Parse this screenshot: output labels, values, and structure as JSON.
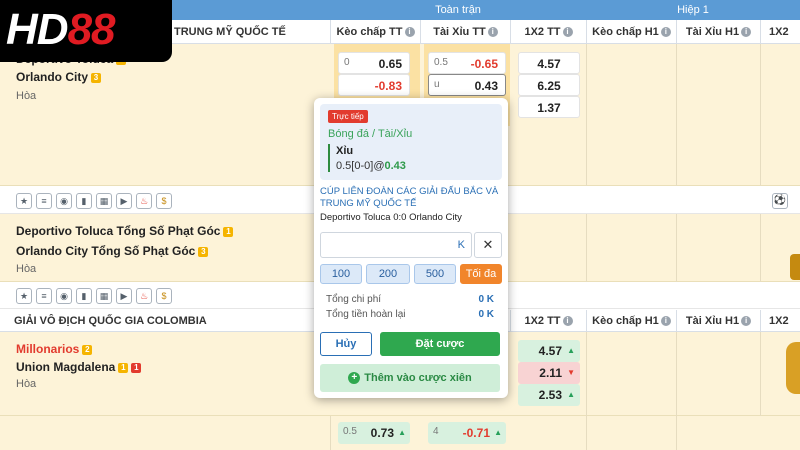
{
  "brand": {
    "logo_text_a": "HD",
    "logo_text_b": "88"
  },
  "header": {
    "group_full": "Toàn trận",
    "group_h1": "Hiệp 1",
    "league": "TRUNG MỸ QUỐC TẾ",
    "cols": [
      "Kèo chấp TT",
      "Tài Xỉu TT",
      "1X2 TT",
      "Kèo chấp H1",
      "Tài Xỉu H1",
      "1X2"
    ]
  },
  "match1": {
    "home": "Deportivo Toluca",
    "away": "Orlando City",
    "away_badge": "3",
    "draw": "Hòa",
    "handicap": [
      {
        "line": "0",
        "odd": "0.65"
      },
      {
        "line": "",
        "odd": "-0.83"
      }
    ],
    "totals": [
      {
        "line": "0.5",
        "odd": "-0.65"
      },
      {
        "line": "u",
        "odd": "0.43"
      }
    ],
    "x12": [
      "4.57",
      "6.25",
      "1.37"
    ]
  },
  "match2": {
    "home": "Deportivo Toluca Tổng Số Phạt Góc",
    "home_badge": "1",
    "away": "Orlando City Tổng Số Phạt Góc",
    "away_badge": "3",
    "draw": "Hòa"
  },
  "section2": {
    "league": "GIẢI VÔ ĐỊCH QUỐC GIA COLOMBIA",
    "cols": [
      "1X2 TT",
      "Kèo chấp H1",
      "Tài Xỉu H1",
      "1X2"
    ]
  },
  "match3": {
    "home": "Millonarios",
    "home_badge": "2",
    "away": "Union Magdalena",
    "away_badge_y": "1",
    "away_badge_r": "1",
    "draw": "Hòa",
    "x12": [
      "4.57",
      "2.11",
      "2.53"
    ],
    "bottom": [
      {
        "line": "0.5",
        "odd": "0.73"
      },
      {
        "line": "4",
        "odd": "-0.71"
      }
    ]
  },
  "icons": [
    "star-icon",
    "database-icon",
    "eye-icon",
    "stats-icon",
    "table-icon",
    "play-icon",
    "fire-icon",
    "coin-icon"
  ],
  "slip": {
    "live": "Trực tiếp",
    "category": "Bóng đá / Tài/Xỉu",
    "pick": "Xỉu",
    "line": "0.5",
    "score": "[0-0]",
    "at": "@",
    "odd": "0.43",
    "league": "CÚP LIÊN ĐOÀN CÁC GIẢI ĐẤU BẮC VÀ TRUNG MỸ QUỐC TẾ",
    "match": "Deportivo Toluca 0:0 Orlando City",
    "stake_unit": "K",
    "close": "✕",
    "chips": [
      "100",
      "200",
      "500",
      "Tối đa"
    ],
    "total_cost_label": "Tổng chi phí",
    "total_cost": "0 K",
    "total_return_label": "Tổng tiền hoàn lại",
    "total_return": "0 K",
    "cancel": "Hủy",
    "place": "Đặt cược",
    "parlay": "Thêm vào cược xiên"
  }
}
